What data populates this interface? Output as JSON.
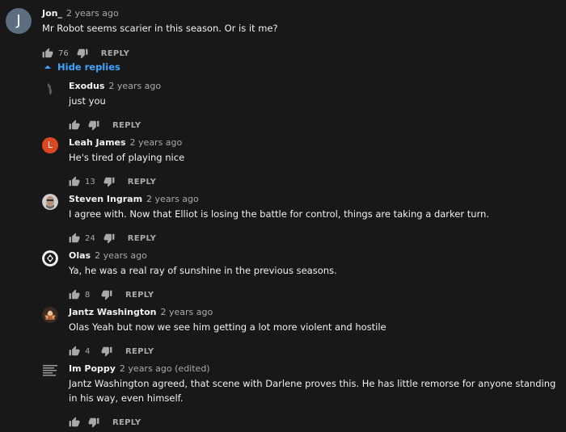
{
  "top_comment": {
    "avatar_letter": "J",
    "author": "Jon_",
    "time": "2 years ago",
    "text": "Mr Robot seems scarier in this season. Or is it me?",
    "likes": "76",
    "reply_label": "REPLY"
  },
  "hide_replies_label": "Hide replies",
  "replies": [
    {
      "author": "Exodus",
      "time": "2 years ago",
      "text": "just you",
      "likes": "",
      "reply_label": "REPLY"
    },
    {
      "author": "Leah James",
      "time": "2 years ago",
      "text": "He's tired of playing nice",
      "likes": "13",
      "reply_label": "REPLY",
      "avatar_letter": "L"
    },
    {
      "author": "Steven Ingram",
      "time": "2 years ago",
      "text": "I agree with.  Now that Elliot is losing the battle for control, things are taking a darker turn.",
      "likes": "24",
      "reply_label": "REPLY"
    },
    {
      "author": "Olas",
      "time": "2 years ago",
      "text": "Ya, he was a real ray of sunshine in the previous seasons.",
      "likes": "8",
      "reply_label": "REPLY"
    },
    {
      "author": "Jantz Washington",
      "time": "2 years ago",
      "text": "Olas Yeah but now we see him getting a lot more violent and hostile",
      "likes": "4",
      "reply_label": "REPLY"
    },
    {
      "author": "Im Poppy",
      "time": "2 years ago (edited)",
      "text": "Jantz Washington agreed, that scene with Darlene proves this. He has little remorse for anyone standing in his way, even himself.",
      "likes": "",
      "reply_label": "REPLY"
    }
  ],
  "colors": {
    "background": "#181818",
    "link_blue": "#3ea6ff",
    "leah_avatar": "#d9481f"
  },
  "icons": {
    "like": "thumbs-up-icon",
    "dislike": "thumbs-down-icon",
    "hide": "chevron-up-icon"
  }
}
